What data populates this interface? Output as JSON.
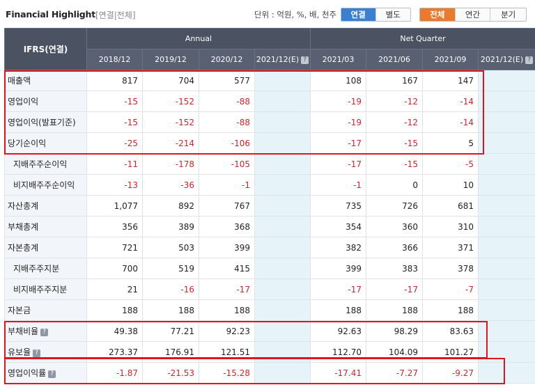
{
  "header": {
    "title": "Financial Highlight",
    "subtitle": "[연결|전체]",
    "unit_label": "단위 : 억원, %, 배, 천주",
    "scope_buttons": [
      {
        "label": "연결",
        "active": true
      },
      {
        "label": "별도",
        "active": false
      }
    ],
    "period_buttons": [
      {
        "label": "전체",
        "active": true
      },
      {
        "label": "연간",
        "active": false
      },
      {
        "label": "분기",
        "active": false
      }
    ]
  },
  "table": {
    "corner_label": "IFRS(연결)",
    "groups": [
      "Annual",
      "Net Quarter"
    ],
    "annual_columns": [
      "2018/12",
      "2019/12",
      "2020/12",
      "2021/12(E)"
    ],
    "quarter_columns": [
      "2021/03",
      "2021/06",
      "2021/09",
      "2021/12(E)"
    ],
    "rows": [
      {
        "label": "매출액",
        "indent": false,
        "help": false,
        "values": [
          "817",
          "704",
          "577",
          "",
          "108",
          "167",
          "147",
          ""
        ]
      },
      {
        "label": "영업이익",
        "indent": false,
        "help": false,
        "values": [
          "-15",
          "-152",
          "-88",
          "",
          "-19",
          "-12",
          "-14",
          ""
        ]
      },
      {
        "label": "영업이익(발표기준)",
        "indent": false,
        "help": false,
        "values": [
          "-15",
          "-152",
          "-88",
          "",
          "-19",
          "-12",
          "-14",
          ""
        ]
      },
      {
        "label": "당기순이익",
        "indent": false,
        "help": false,
        "values": [
          "-25",
          "-214",
          "-106",
          "",
          "-17",
          "-15",
          "5",
          ""
        ]
      },
      {
        "label": "지배주주순이익",
        "indent": true,
        "help": false,
        "values": [
          "-11",
          "-178",
          "-105",
          "",
          "-17",
          "-15",
          "-5",
          ""
        ]
      },
      {
        "label": "비지배주주순이익",
        "indent": true,
        "help": false,
        "values": [
          "-13",
          "-36",
          "-1",
          "",
          "-1",
          "0",
          "10",
          ""
        ]
      },
      {
        "label": "자산총계",
        "indent": false,
        "help": false,
        "values": [
          "1,077",
          "892",
          "767",
          "",
          "735",
          "726",
          "681",
          ""
        ]
      },
      {
        "label": "부채총계",
        "indent": false,
        "help": false,
        "values": [
          "356",
          "389",
          "368",
          "",
          "354",
          "360",
          "310",
          ""
        ]
      },
      {
        "label": "자본총계",
        "indent": false,
        "help": false,
        "values": [
          "721",
          "503",
          "399",
          "",
          "382",
          "366",
          "371",
          ""
        ]
      },
      {
        "label": "지배주주지분",
        "indent": true,
        "help": false,
        "values": [
          "700",
          "519",
          "415",
          "",
          "399",
          "383",
          "378",
          ""
        ]
      },
      {
        "label": "비지배주주지분",
        "indent": true,
        "help": false,
        "values": [
          "21",
          "-16",
          "-17",
          "",
          "-17",
          "-17",
          "-7",
          ""
        ]
      },
      {
        "label": "자본금",
        "indent": false,
        "help": false,
        "values": [
          "188",
          "188",
          "188",
          "",
          "188",
          "188",
          "188",
          ""
        ]
      },
      {
        "label": "부채비율",
        "indent": false,
        "help": true,
        "values": [
          "49.38",
          "77.21",
          "92.23",
          "",
          "92.63",
          "98.29",
          "83.63",
          ""
        ]
      },
      {
        "label": "유보율",
        "indent": false,
        "help": true,
        "values": [
          "273.37",
          "176.91",
          "121.51",
          "",
          "112.70",
          "104.09",
          "101.27",
          ""
        ]
      },
      {
        "label": "영업이익률",
        "indent": false,
        "help": true,
        "values": [
          "-1.87",
          "-21.53",
          "-15.28",
          "",
          "-17.41",
          "-7.27",
          "-9.27",
          ""
        ]
      }
    ]
  },
  "help_icon_glyph": "?",
  "colors": {
    "header_bg": "#4b5262",
    "negative": "#c7282e",
    "scope_active": "#3a7fd0",
    "period_active": "#ea7a2e",
    "estimate_bg": "#e6f3f8",
    "highlight_box": "#e2141a"
  }
}
